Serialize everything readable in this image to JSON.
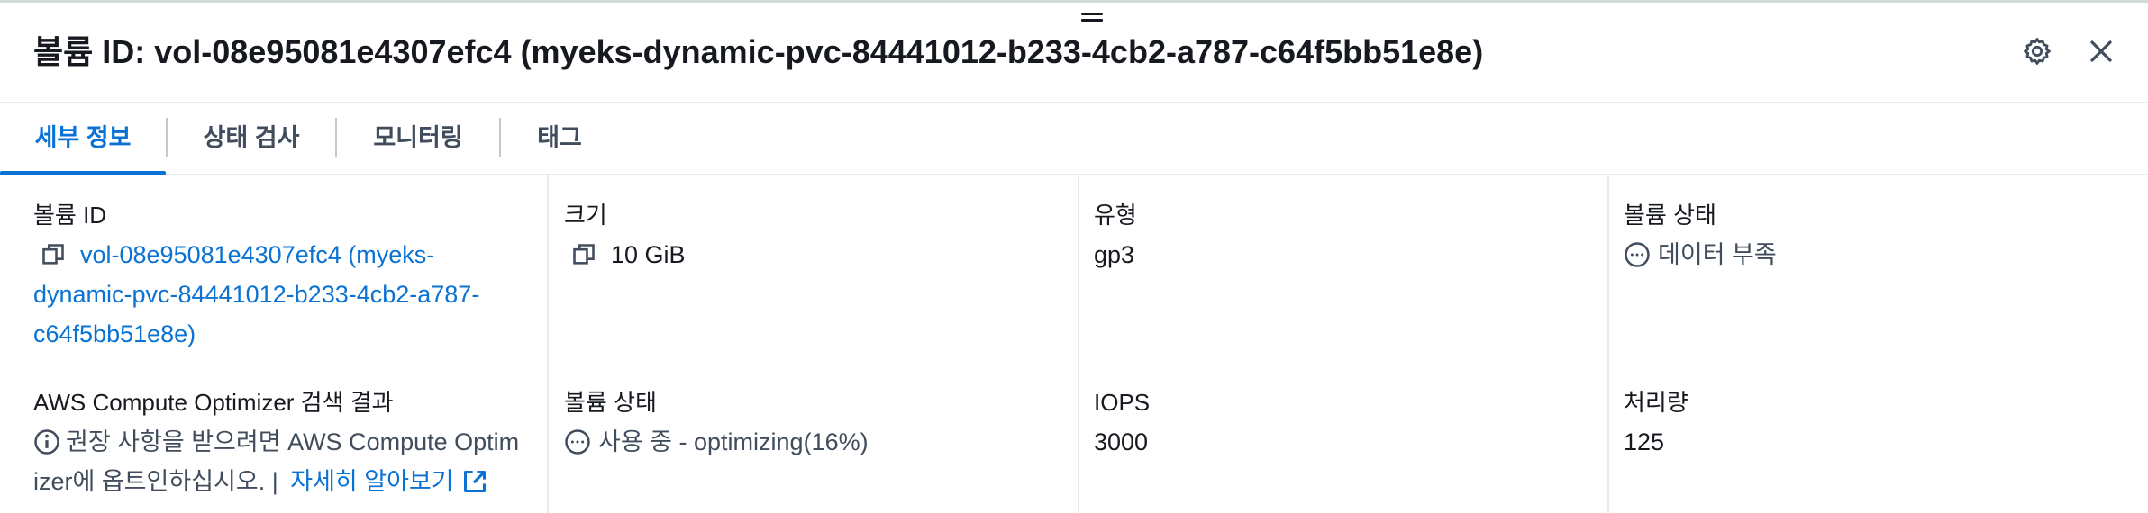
{
  "header": {
    "title": "볼륨 ID: vol-08e95081e4307efc4 (myeks-dynamic-pvc-84441012-b233-4cb2-a787-c64f5bb51e8e)",
    "settings_icon": "gear-icon",
    "close_icon": "close-icon"
  },
  "tabs": [
    {
      "label": "세부 정보",
      "active": true
    },
    {
      "label": "상태 검사",
      "active": false
    },
    {
      "label": "모니터링",
      "active": false
    },
    {
      "label": "태그",
      "active": false
    }
  ],
  "details": {
    "volume_id": {
      "label": "볼륨 ID",
      "line1": "vol-08e95081e4307efc4 (myeks-",
      "line2": "dynamic-pvc-84441012-b233-4cb2-a787-",
      "line3": "c64f5bb51e8e)",
      "icon": "copy-icon"
    },
    "size": {
      "label": "크기",
      "value": "10 GiB",
      "icon": "copy-icon"
    },
    "type": {
      "label": "유형",
      "value": "gp3"
    },
    "volume_status": {
      "label": "볼륨 상태",
      "value": "데이터 부족",
      "icon": "pending-icon"
    },
    "optimizer": {
      "label": "AWS Compute Optimizer 검색 결과",
      "line1": "권장 사항을 받으려면 AWS Compute Optim",
      "line2": "izer에 옵트인하십시오. | ",
      "link": "자세히 알아보기",
      "info_icon": "info-icon",
      "external_icon": "external-link-icon"
    },
    "volume_state": {
      "label": "볼륨 상태",
      "value": "사용 중 - optimizing(16%)",
      "icon": "pending-icon"
    },
    "iops": {
      "label": "IOPS",
      "value": "3000"
    },
    "throughput": {
      "label": "처리량",
      "value": "125"
    }
  },
  "colors": {
    "accent": "#0972d3",
    "text": "#16191f",
    "muted": "#414d5c",
    "divider": "#e9ebed"
  }
}
